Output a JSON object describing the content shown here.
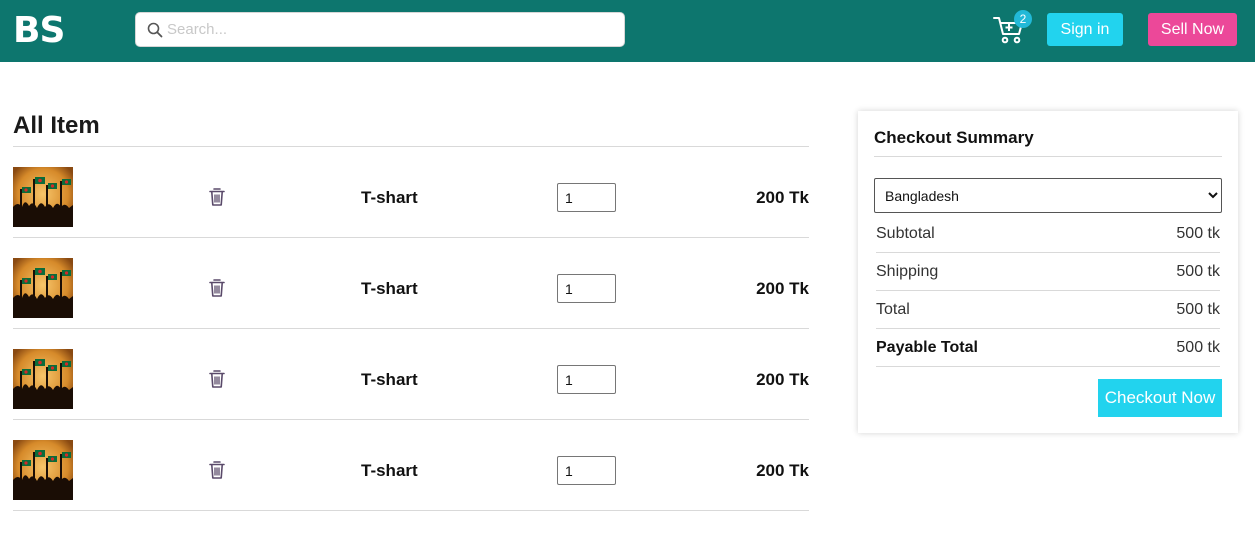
{
  "header": {
    "logo": "BS",
    "search_placeholder": "Search...",
    "cart_count": "2",
    "signin_label": "Sign in",
    "sell_label": "Sell Now",
    "colors": {
      "bar": "#0d766e",
      "signin": "#22d3ee",
      "sell": "#ec4899",
      "badge": "#22b9d8"
    }
  },
  "items": {
    "title": "All Item",
    "rows": [
      {
        "name": "T-shart",
        "qty": "1",
        "price": "200 Tk",
        "image_icon": "flag-crowd-image"
      },
      {
        "name": "T-shart",
        "qty": "1",
        "price": "200 Tk",
        "image_icon": "flag-crowd-image"
      },
      {
        "name": "T-shart",
        "qty": "1",
        "price": "200 Tk",
        "image_icon": "flag-crowd-image"
      },
      {
        "name": "T-shart",
        "qty": "1",
        "price": "200 Tk",
        "image_icon": "flag-crowd-image"
      }
    ]
  },
  "summary": {
    "title": "Checkout Summary",
    "country_selected": "Bangladesh",
    "rows": [
      {
        "label": "Subtotal",
        "value": "500 tk"
      },
      {
        "label": "Shipping",
        "value": "500 tk"
      },
      {
        "label": "Total",
        "value": "500 tk"
      },
      {
        "label": "Payable Total",
        "value": "500 tk"
      }
    ],
    "checkout_label": "Checkout Now"
  }
}
